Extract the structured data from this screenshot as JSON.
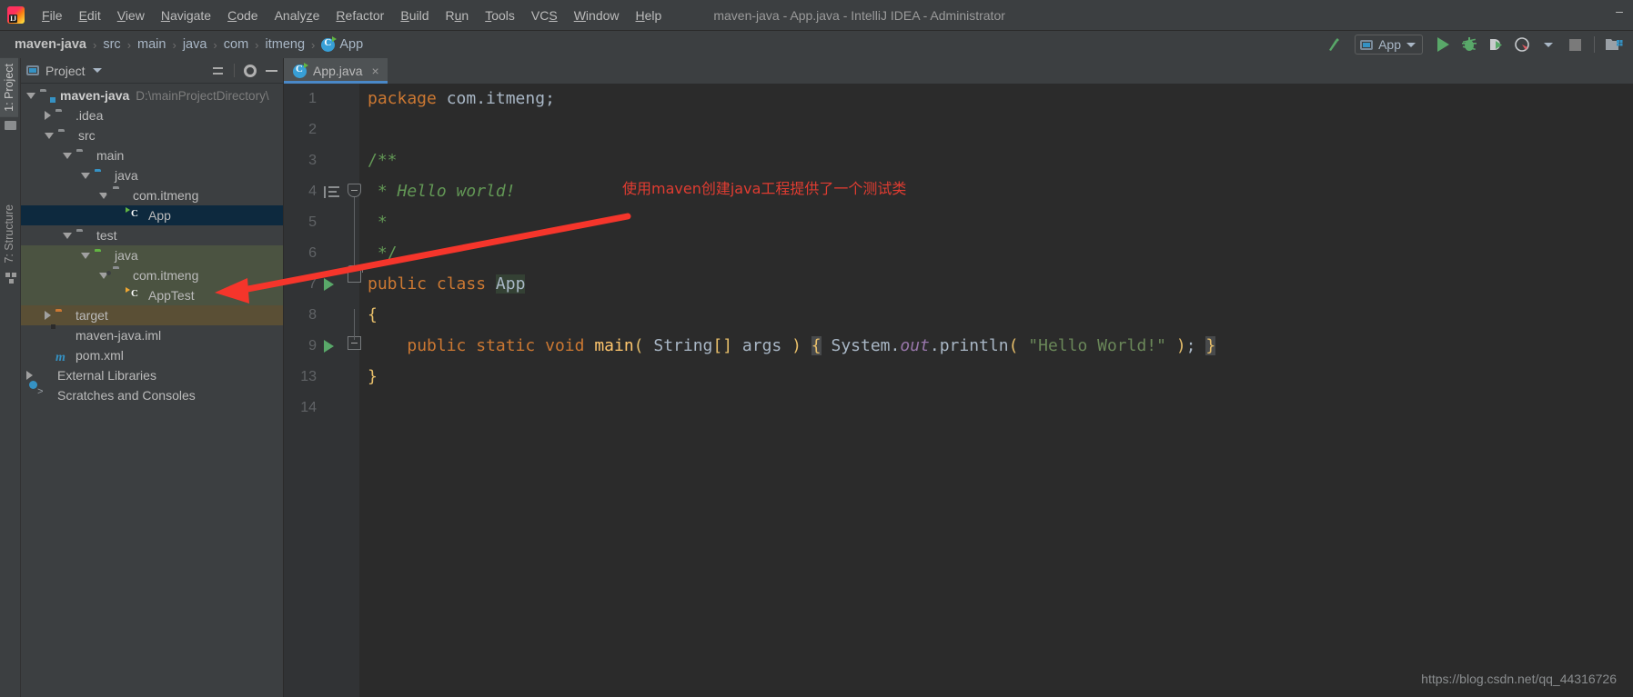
{
  "window": {
    "title": "maven-java - App.java - IntelliJ IDEA - Administrator",
    "minimize_label": "–",
    "logo_name": "intellij-idea-logo"
  },
  "menu": {
    "items": [
      {
        "label": "File",
        "mnemonic": "F"
      },
      {
        "label": "Edit",
        "mnemonic": "E"
      },
      {
        "label": "View",
        "mnemonic": "V"
      },
      {
        "label": "Navigate",
        "mnemonic": "N"
      },
      {
        "label": "Code",
        "mnemonic": "C"
      },
      {
        "label": "Analyze",
        "mnemonic": "z"
      },
      {
        "label": "Refactor",
        "mnemonic": "R"
      },
      {
        "label": "Build",
        "mnemonic": "B"
      },
      {
        "label": "Run",
        "mnemonic": "u"
      },
      {
        "label": "Tools",
        "mnemonic": "T"
      },
      {
        "label": "VCS",
        "mnemonic": "S"
      },
      {
        "label": "Window",
        "mnemonic": "W"
      },
      {
        "label": "Help",
        "mnemonic": "H"
      }
    ]
  },
  "navbar": {
    "crumbs": [
      "maven-java",
      "src",
      "main",
      "java",
      "com",
      "itmeng",
      "App"
    ],
    "separator": "›"
  },
  "toolbar": {
    "build_label": "Build",
    "run_config": "App",
    "run_label": "Run",
    "debug_label": "Debug",
    "run_coverage_label": "Run with Coverage",
    "profiler_label": "Profiler",
    "stop_label": "Stop",
    "project_structure_label": "Project Structure"
  },
  "stripe": {
    "project": "1: Project",
    "structure": "7: Structure"
  },
  "project_panel": {
    "title": "Project",
    "collapse_all_label": "Collapse All",
    "settings_label": "Settings",
    "hide_label": "Hide",
    "tree": [
      {
        "label": "maven-java",
        "sub": "D:\\mainProjectDirectory\\",
        "icon": "module-icon",
        "twisty": "open",
        "indent": 0,
        "style": "bold",
        "row": "normal"
      },
      {
        "label": ".idea",
        "sub": "",
        "icon": "folder-icon",
        "twisty": "closed",
        "indent": 1,
        "style": "",
        "row": "normal"
      },
      {
        "label": "src",
        "sub": "",
        "icon": "folder-icon",
        "twisty": "open",
        "indent": 1,
        "style": "",
        "row": "normal"
      },
      {
        "label": "main",
        "sub": "",
        "icon": "folder-icon",
        "twisty": "open",
        "indent": 2,
        "style": "",
        "row": "normal"
      },
      {
        "label": "java",
        "sub": "",
        "icon": "source-root-icon",
        "twisty": "open",
        "indent": 3,
        "style": "",
        "row": "normal"
      },
      {
        "label": "com.itmeng",
        "sub": "",
        "icon": "package-icon",
        "twisty": "open",
        "indent": 4,
        "style": "",
        "row": "normal"
      },
      {
        "label": "App",
        "sub": "",
        "icon": "java-class-icon",
        "twisty": "none",
        "indent": 5,
        "style": "",
        "row": "selected"
      },
      {
        "label": "test",
        "sub": "",
        "icon": "folder-icon",
        "twisty": "open",
        "indent": 2,
        "style": "",
        "row": "normal"
      },
      {
        "label": "java",
        "sub": "",
        "icon": "test-root-icon",
        "twisty": "open",
        "indent": 3,
        "style": "",
        "row": "test-source"
      },
      {
        "label": "com.itmeng",
        "sub": "",
        "icon": "package-icon",
        "twisty": "open",
        "indent": 4,
        "style": "",
        "row": "test-source"
      },
      {
        "label": "AppTest",
        "sub": "",
        "icon": "java-test-class-icon",
        "twisty": "none",
        "indent": 5,
        "style": "",
        "row": "test-source"
      },
      {
        "label": "target",
        "sub": "",
        "icon": "excluded-folder-icon",
        "twisty": "closed",
        "indent": 1,
        "style": "",
        "row": "excluded"
      },
      {
        "label": "maven-java.iml",
        "sub": "",
        "icon": "iml-file-icon",
        "twisty": "none",
        "indent": 1,
        "style": "",
        "row": "normal"
      },
      {
        "label": "pom.xml",
        "sub": "",
        "icon": "maven-file-icon",
        "twisty": "none",
        "indent": 1,
        "style": "",
        "row": "normal"
      },
      {
        "label": "External Libraries",
        "sub": "",
        "icon": "libraries-icon",
        "twisty": "closed",
        "indent": 0,
        "style": "",
        "row": "normal"
      },
      {
        "label": "Scratches and Consoles",
        "sub": "",
        "icon": "scratches-icon",
        "twisty": "none",
        "indent": 0,
        "style": "",
        "row": "normal"
      }
    ]
  },
  "editor": {
    "tab": {
      "label": "App.java",
      "close": "×",
      "icon": "java-class-icon"
    },
    "lines": [
      {
        "num": "1",
        "tokens": [
          {
            "t": "package",
            "c": "kw"
          },
          {
            "t": " ",
            "c": "pln"
          },
          {
            "t": "com.itmeng",
            "c": "pln"
          },
          {
            "t": ";",
            "c": "pln"
          }
        ]
      },
      {
        "num": "2",
        "tokens": []
      },
      {
        "num": "3",
        "tokens": [
          {
            "t": "/**",
            "c": "cmt2"
          }
        ]
      },
      {
        "num": "4",
        "tokens": [
          {
            "t": " * Hello world!",
            "c": "cmt"
          }
        ]
      },
      {
        "num": "5",
        "tokens": [
          {
            "t": " *",
            "c": "cmt2"
          }
        ]
      },
      {
        "num": "6",
        "tokens": [
          {
            "t": " */",
            "c": "cmt2"
          }
        ]
      },
      {
        "num": "7",
        "tokens": [
          {
            "t": "public",
            "c": "kw"
          },
          {
            "t": " ",
            "c": "pln"
          },
          {
            "t": "class",
            "c": "kw"
          },
          {
            "t": " ",
            "c": "pln"
          },
          {
            "t": "App",
            "c": "pln hl-id"
          }
        ]
      },
      {
        "num": "8",
        "tokens": [
          {
            "t": "{",
            "c": "yel"
          }
        ]
      },
      {
        "num": "9",
        "tokens": [
          {
            "t": "    ",
            "c": "pln"
          },
          {
            "t": "public",
            "c": "kw"
          },
          {
            "t": " ",
            "c": "pln"
          },
          {
            "t": "static",
            "c": "kw"
          },
          {
            "t": " ",
            "c": "pln"
          },
          {
            "t": "void",
            "c": "kw"
          },
          {
            "t": " ",
            "c": "pln"
          },
          {
            "t": "main",
            "c": "mth"
          },
          {
            "t": "(",
            "c": "yel"
          },
          {
            "t": " ",
            "c": "pln"
          },
          {
            "t": "String",
            "c": "pln"
          },
          {
            "t": "[]",
            "c": "yel"
          },
          {
            "t": " args ",
            "c": "pln"
          },
          {
            "t": ")",
            "c": "yel"
          },
          {
            "t": " ",
            "c": "pln"
          },
          {
            "t": "{",
            "c": "yel hl-grey"
          },
          {
            "t": " ",
            "c": "pln"
          },
          {
            "t": "System",
            "c": "pln"
          },
          {
            "t": ".",
            "c": "pln"
          },
          {
            "t": "out",
            "c": "fld"
          },
          {
            "t": ".",
            "c": "pln"
          },
          {
            "t": "println",
            "c": "pln"
          },
          {
            "t": "(",
            "c": "yel"
          },
          {
            "t": " ",
            "c": "pln"
          },
          {
            "t": "\"Hello World!\"",
            "c": "str"
          },
          {
            "t": " ",
            "c": "pln"
          },
          {
            "t": ")",
            "c": "yel"
          },
          {
            "t": ";",
            "c": "pln"
          },
          {
            "t": " ",
            "c": "pln"
          },
          {
            "t": "}",
            "c": "yel hl-grey"
          }
        ]
      },
      {
        "num": "13",
        "tokens": [
          {
            "t": "}",
            "c": "yel"
          }
        ]
      },
      {
        "num": "14",
        "tokens": []
      }
    ],
    "gutter": {
      "run_marker_label": "Run",
      "fold_label": "Collapse",
      "expand_label": "Expand"
    }
  },
  "annotation": {
    "text": "使用maven创建java工程提供了一个测试类",
    "color": "#e03c31",
    "arrow_name": "red-arrow-annotation"
  },
  "watermark": {
    "text": "https://blog.csdn.net/qq_44316726"
  },
  "colors": {
    "chrome": "#3c3f41",
    "editor_bg": "#2b2b2b",
    "gutter_bg": "#313335",
    "selection": "#0d293e",
    "test_source": "#4b5341",
    "excluded": "#5a4f35",
    "accent_blue": "#4a88c7",
    "green_run": "#59a869",
    "annotation_red": "#e03c31"
  }
}
